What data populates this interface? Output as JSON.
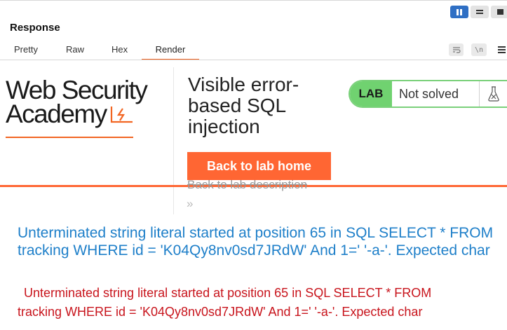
{
  "panel": {
    "title": "Response",
    "tabs": [
      "Pretty",
      "Raw",
      "Hex",
      "Render"
    ],
    "active_tab": "Render",
    "accent_color": "#f26522",
    "toolbar_icons": [
      "wrap-lines-icon",
      "newline-icon",
      "menu-icon"
    ],
    "newline_label": "\\n",
    "layout_toggles": [
      "split-vertical-icon",
      "split-horizontal-icon",
      "single-panel-icon"
    ]
  },
  "page": {
    "logo": {
      "line1": "Web Security",
      "line2": "Academy",
      "icon": "lightning-bolt-icon"
    },
    "lab_title": "Visible error-based SQL injection",
    "status": {
      "badge": "LAB",
      "text": "Not solved",
      "icon": "flask-icon",
      "badge_color": "#70d270"
    },
    "back_button": "Back to lab home",
    "back_description": "Back to lab description",
    "chevron": "»",
    "button_color": "#ff6633",
    "error_heading": "Unterminated string literal started at position 65 in SQL SELECT * FROM tracking WHERE id = 'K04Qy8nv0sd7JRdW' And 1=' '-a-'. Expected char",
    "error_line1": "Unterminated string literal started at position 65 in SQL SELECT * FROM",
    "error_line2": "tracking WHERE id = 'K04Qy8nv0sd7JRdW' And 1=' '-a-'. Expected char"
  }
}
